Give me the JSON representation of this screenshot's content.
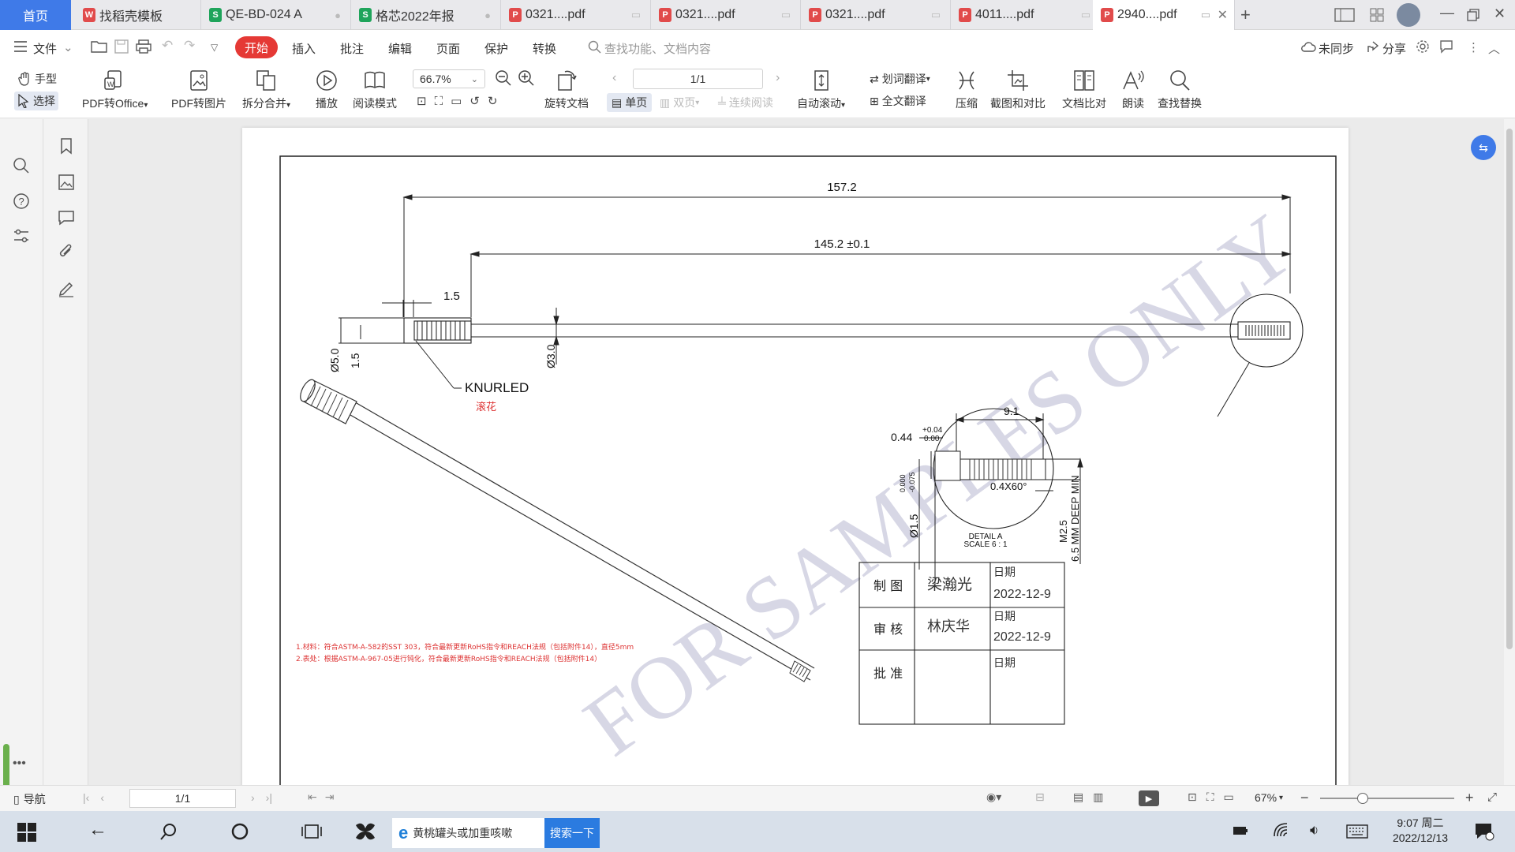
{
  "tabs": [
    {
      "label": "首页"
    },
    {
      "label": "找稻壳模板"
    },
    {
      "label": "QE-BD-024 A"
    },
    {
      "label": "格芯2022年报"
    },
    {
      "label": "0321....pdf"
    },
    {
      "label": "0321....pdf"
    },
    {
      "label": "0321....pdf"
    },
    {
      "label": "4011....pdf"
    },
    {
      "label": "2940....pdf"
    }
  ],
  "menu": {
    "file": "文件",
    "start": "开始",
    "items": [
      "插入",
      "批注",
      "编辑",
      "页面",
      "保护",
      "转换"
    ],
    "search_placeholder": "查找功能、文档内容",
    "sync": "未同步",
    "share": "分享"
  },
  "ribbon": {
    "hand": "手型",
    "select": "选择",
    "pdf_to_office": "PDF转Office",
    "pdf_to_image": "PDF转图片",
    "split_merge": "拆分合并",
    "play": "播放",
    "read_mode": "阅读模式",
    "zoom": "66.7%",
    "rotate_doc": "旋转文档",
    "page_num": "1/1",
    "single_page": "单页",
    "double_page": "双页",
    "continuous": "连续阅读",
    "auto_scroll": "自动滚动",
    "word_translate": "划词翻译",
    "full_translate": "全文翻译",
    "compress": "压缩",
    "screenshot_compare": "截图和对比",
    "doc_compare": "文档比对",
    "read_aloud": "朗读",
    "find_replace": "查找替换"
  },
  "drawing": {
    "dim_overall": "157.2",
    "dim_shaft": "145.2 ±0.1",
    "dim_knurl_len": "1.5",
    "dim_dia5": "Ø5.0",
    "dim_15": "1.5",
    "dim_dia3": "Ø3.0",
    "knurled": "KNURLED",
    "knurled_cn": "滚花",
    "watermark": "FOR SAMPLES ONLY",
    "detail_91": "9.1",
    "detail_044": "0.44",
    "detail_tol_up": "+0.04",
    "detail_tol_dn": "0.00",
    "detail_dia15": "Ø1.5",
    "detail_dia15_tol_up": "0.000",
    "detail_dia15_tol_dn": "-0.075",
    "detail_chamfer": "0.4X60°",
    "detail_thread": "M2.5",
    "detail_depth": "6.5  MM DEEP MIN",
    "detail_title": "DETAIL A",
    "detail_scale": "SCALE 6 : 1",
    "tb_drawn": "制 图",
    "tb_drawn_name": "梁瀚光",
    "tb_date_label": "日期",
    "tb_date1": "2022-12-9",
    "tb_check": "审 核",
    "tb_check_name": "林庆华",
    "tb_date2": "2022-12-9",
    "tb_approve": "批 准",
    "note1": "1.材料：符合ASTM-A-582的SST 303，符合最新更新RoHS指令和REACH法规（包括附件14），直径5mm",
    "note2": "2.表处：根据ASTM-A-967-05进行钝化，符合最新更新RoHS指令和REACH法规（包括附件14）"
  },
  "status": {
    "nav": "导航",
    "page": "1/1",
    "zoom": "67%"
  },
  "taskbar": {
    "search_text": "黄桃罐头或加重咳嗽",
    "search_btn": "搜索一下",
    "time": "9:07 周二",
    "date": "2022/12/13"
  },
  "colors": {
    "accent": "#3f7ae8",
    "start": "#e53935",
    "pdf_red": "#e14b4b",
    "sheet_green": "#1fa45b"
  }
}
